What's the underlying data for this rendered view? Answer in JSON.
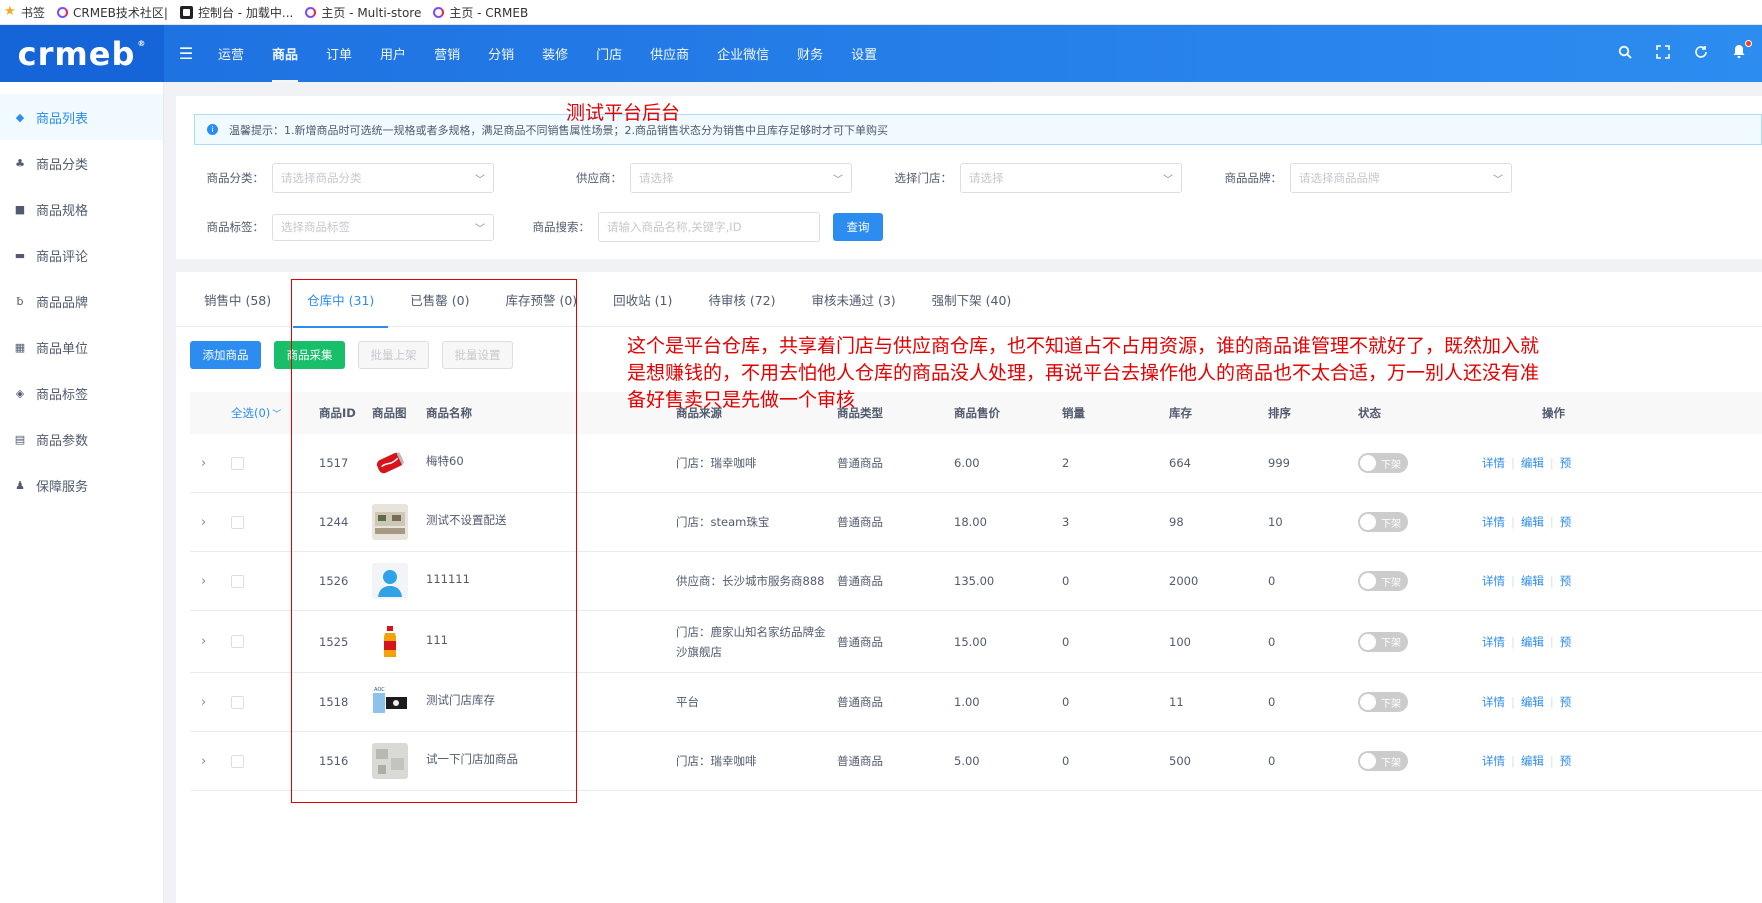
{
  "bookmarks": [
    {
      "icon": "star-icon",
      "label": "书签"
    },
    {
      "icon": "crmeb-c-icon",
      "label": "CRMEB技术社区|"
    },
    {
      "icon": "dashboard-icon",
      "label": "控制台 - 加载中..."
    },
    {
      "icon": "crmeb-c-icon",
      "label": "主页 - Multi-store"
    },
    {
      "icon": "crmeb-c-icon",
      "label": "主页 - CRMEB"
    }
  ],
  "header": {
    "logo": "crmeb",
    "logo_mark": "®",
    "nav": [
      "运营",
      "商品",
      "订单",
      "用户",
      "营销",
      "分销",
      "装修",
      "门店",
      "供应商",
      "企业微信",
      "财务",
      "设置"
    ],
    "active_nav": "商品"
  },
  "sidebar": {
    "items": [
      {
        "label": "商品列表",
        "icon": "shop-icon"
      },
      {
        "label": "商品分类",
        "icon": "category-icon"
      },
      {
        "label": "商品规格",
        "icon": "cube-icon"
      },
      {
        "label": "商品评论",
        "icon": "comment-icon"
      },
      {
        "label": "商品品牌",
        "icon": "brand-icon"
      },
      {
        "label": "商品单位",
        "icon": "grid-icon"
      },
      {
        "label": "商品标签",
        "icon": "tag-icon"
      },
      {
        "label": "商品参数",
        "icon": "list-icon"
      },
      {
        "label": "保障服务",
        "icon": "person-icon"
      }
    ]
  },
  "overlay_title": "测试平台后台",
  "alert": {
    "text": "温馨提示：1.新增商品时可选统一规格或者多规格，满足商品不同销售属性场景；2.商品销售状态分为销售中且库存足够时才可下单购买"
  },
  "filters": {
    "category_label": "商品分类：",
    "category_placeholder": "请选择商品分类",
    "supplier_label": "供应商：",
    "supplier_placeholder": "请选择",
    "store_label": "选择门店：",
    "store_placeholder": "请选择",
    "brand_label": "商品品牌：",
    "brand_placeholder": "请选择商品品牌",
    "tag_label": "商品标签：",
    "tag_placeholder": "选择商品标签",
    "search_label": "商品搜索：",
    "search_placeholder": "请输入商品名称,关键字,ID",
    "query_button": "查询"
  },
  "tabs": [
    "销售中 (58)",
    "仓库中 (31)",
    "已售罄 (0)",
    "库存预警 (0)",
    "回收站 (1)",
    "待审核 (72)",
    "审核未通过 (3)",
    "强制下架 (40)"
  ],
  "active_tab": "仓库中 (31)",
  "actions": {
    "add": "添加商品",
    "collect": "商品采集",
    "batch_up": "批量上架",
    "batch_set": "批量设置"
  },
  "table": {
    "select_all": "全选(0)",
    "headers": {
      "id": "商品ID",
      "image": "商品图",
      "name": "商品名称",
      "source": "商品来源",
      "type": "商品类型",
      "price": "商品售价",
      "sales": "销量",
      "stock": "库存",
      "sort": "排序",
      "status": "状态",
      "ops": "操作"
    },
    "rows": [
      {
        "id": "1517",
        "name": "梅特60",
        "source": "门店：瑞幸咖啡",
        "type": "普通商品",
        "price": "6.00",
        "sales": "2",
        "stock": "664",
        "sort": "999",
        "status": "下架",
        "thumb": "coke-can-icon"
      },
      {
        "id": "1244",
        "name": "测试不设置配送",
        "source": "门店：steam珠宝",
        "type": "普通商品",
        "price": "18.00",
        "sales": "3",
        "stock": "98",
        "sort": "10",
        "status": "下架",
        "thumb": "room-photo-icon"
      },
      {
        "id": "1526",
        "name": "111111",
        "source": "供应商：长沙城市服务商888",
        "type": "普通商品",
        "price": "135.00",
        "sales": "0",
        "stock": "2000",
        "sort": "0",
        "status": "下架",
        "thumb": "user-avatar-icon"
      },
      {
        "id": "1525",
        "name": "111",
        "source": "门店：鹿家山知名家纺品牌金沙旗舰店",
        "type": "普通商品",
        "price": "15.00",
        "sales": "0",
        "stock": "100",
        "sort": "0",
        "status": "下架",
        "thumb": "bottle-icon"
      },
      {
        "id": "1518",
        "name": "测试门店库存",
        "source": "平台",
        "type": "普通商品",
        "price": "1.00",
        "sales": "0",
        "stock": "11",
        "sort": "0",
        "status": "下架",
        "thumb": "product-banner-icon"
      },
      {
        "id": "1516",
        "name": "试一下门店加商品",
        "source": "门店：瑞幸咖啡",
        "type": "普通商品",
        "price": "5.00",
        "sales": "0",
        "stock": "500",
        "sort": "0",
        "status": "下架",
        "thumb": "gray-photo-icon"
      }
    ],
    "op_links": [
      "详情",
      "编辑",
      "预"
    ]
  },
  "annotation": "这个是平台仓库，共享着门店与供应商仓库，也不知道占不占用资源，谁的商品谁管理不就好了，既然加入就是想赚钱的，不用去怕他人仓库的商品没人处理，再说平台去操作他人的商品也不太合适，万一别人还没有准备好售卖只是先做一个审核",
  "colors": {
    "primary": "#2d8cf0",
    "green": "#19be6b",
    "annotation_red": "#e30000"
  }
}
